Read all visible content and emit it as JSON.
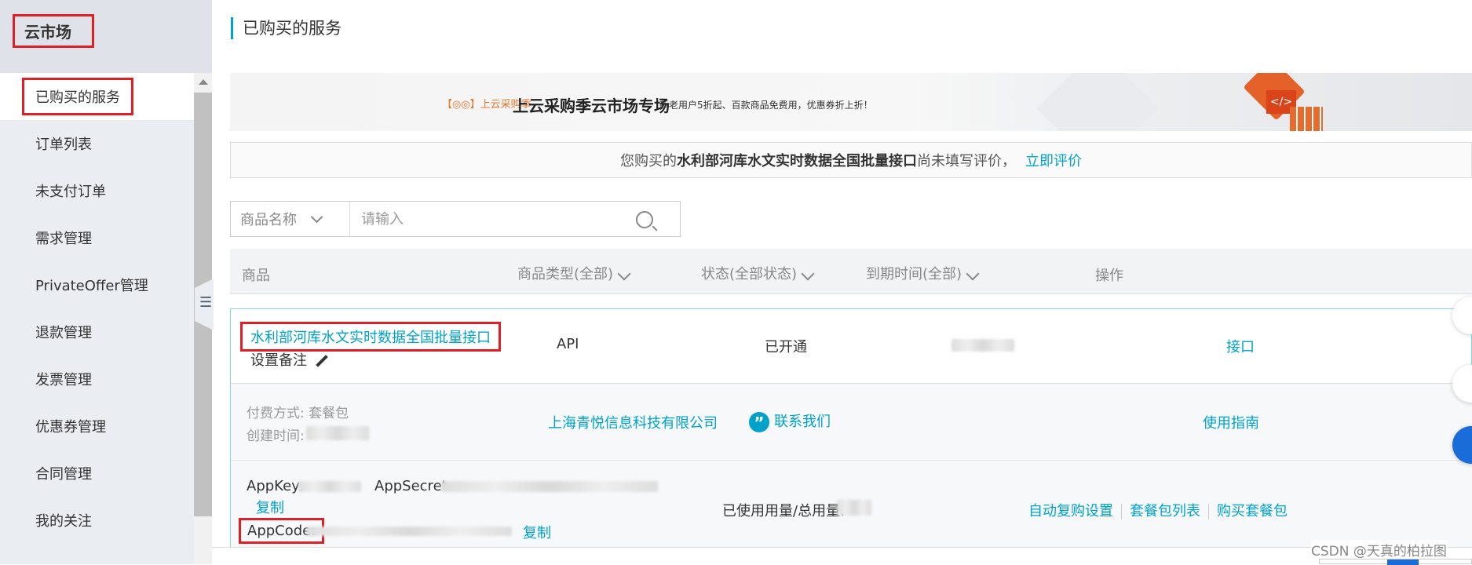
{
  "sidebar": {
    "title": "云市场",
    "items": [
      {
        "label": "已购买的服务",
        "active": true
      },
      {
        "label": "订单列表"
      },
      {
        "label": "未支付订单"
      },
      {
        "label": "需求管理"
      },
      {
        "label": "PrivateOffer管理"
      },
      {
        "label": "退款管理"
      },
      {
        "label": "发票管理"
      },
      {
        "label": "优惠券管理"
      },
      {
        "label": "合同管理"
      },
      {
        "label": "我的关注"
      }
    ]
  },
  "page": {
    "title": "已购买的服务"
  },
  "banner": {
    "logo": "【◎◎】上云采购季",
    "title": "上云采购季云市场专场",
    "subtitle": "新老用户5折起、百款商品免费用，优惠券折上折！"
  },
  "review": {
    "prefix": "您购买的",
    "product": "水利部河库水文实时数据全国批量接口",
    "suffix": "尚未填写评价，",
    "action": "立即评价"
  },
  "search": {
    "filter_label": "商品名称",
    "placeholder": "请输入"
  },
  "table": {
    "headers": {
      "product": "商品",
      "type": "商品类型(全部)",
      "status": "状态(全部状态)",
      "expire": "到期时间(全部)",
      "ops": "操作"
    },
    "row": {
      "product": "水利部河库水文实时数据全国批量接口",
      "note": "设置备注",
      "type": "API",
      "status": "已开通",
      "op": "接口",
      "pay_label": "付费方式:",
      "pay_value": "套餐包",
      "created_label": "创建时间:",
      "vendor": "上海青悦信息科技有限公司",
      "contact": "联系我们",
      "guide": "使用指南",
      "appkey_label": "AppKey:",
      "appsecret_label": "AppSecret:",
      "copy1": "复制",
      "appcode_label": "AppCode:",
      "copy2": "复制",
      "usage_label": "已使用用量/总用量:",
      "auto_renew": "自动复购设置",
      "package_list": "套餐包列表",
      "buy_package": "购买套餐包"
    }
  },
  "watermark": "CSDN @天真的柏拉图",
  "colors": {
    "accent": "#00a2ca",
    "highlight": "#e01e26",
    "float_blue": "#1a6dd8"
  }
}
